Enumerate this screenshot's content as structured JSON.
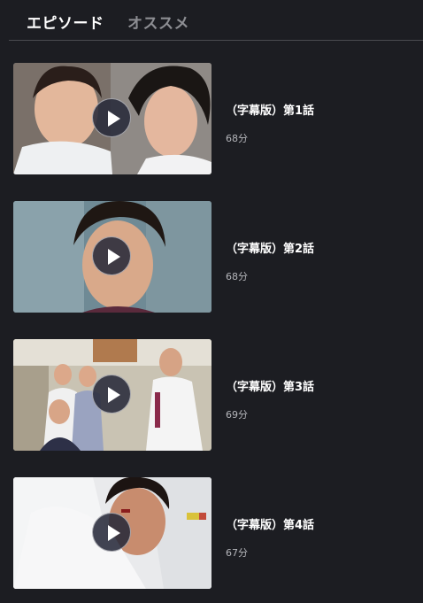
{
  "tabs": {
    "episodes": "エピソード",
    "recommended": "オススメ"
  },
  "episodes": [
    {
      "title": "（字幕版）第1話",
      "duration": "68分"
    },
    {
      "title": "（字幕版）第2話",
      "duration": "68分"
    },
    {
      "title": "（字幕版）第3話",
      "duration": "69分"
    },
    {
      "title": "（字幕版）第4話",
      "duration": "67分"
    }
  ],
  "colors": {
    "background": "#1c1d22",
    "tab_active": "#ffffff",
    "tab_inactive": "#8d8e93",
    "duration_text": "#b4b5ba"
  },
  "icons": {
    "play": "play-icon"
  }
}
